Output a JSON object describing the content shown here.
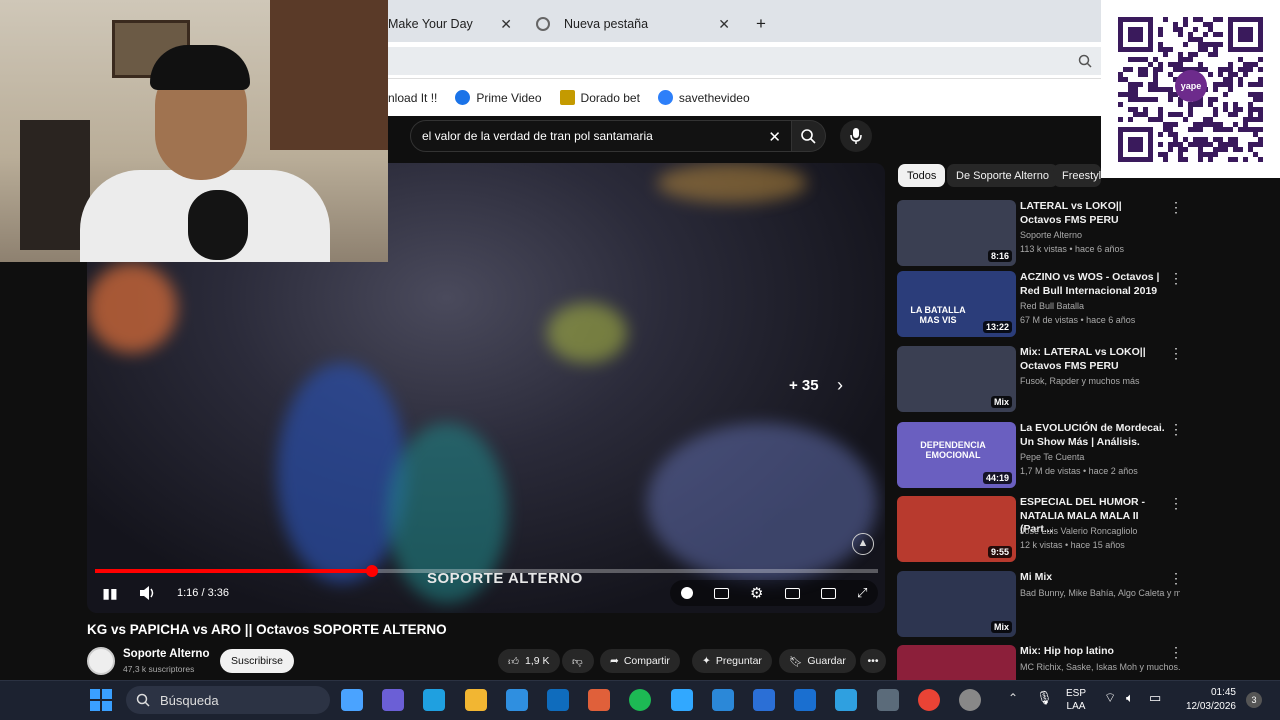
{
  "browser": {
    "tabs": [
      {
        "label": "Make Your Day",
        "close": "✕"
      },
      {
        "label": "Nueva pestaña",
        "close": "✕"
      }
    ],
    "new_tab": "+",
    "bookmarks": [
      {
        "label": "nload It !!",
        "color": "#e53935"
      },
      {
        "label": "Prime Video",
        "color": "#1a73e8"
      },
      {
        "label": "Dorado bet",
        "color": "#c49a00"
      },
      {
        "label": "savethevideo",
        "color": "#2d7ff9"
      }
    ]
  },
  "youtube": {
    "search_value": "el valor de la verdad de tran pol santamaria",
    "chips": [
      "Todos",
      "De Soporte Alterno",
      "Freestyle Rap"
    ],
    "video": {
      "overlay_count": "+ 35",
      "watermark": "SOPORTE ALTERNO",
      "time": "1:16 / 3:36",
      "progress": 0.355,
      "title": "KG vs PAPICHA vs ARO || Octavos SOPORTE ALTERNO"
    },
    "channel": {
      "name": "Soporte Alterno",
      "subs": "47,3 k suscriptores",
      "subscribe": "Suscribirse"
    },
    "actions": {
      "likes": "1,9 K",
      "share": "Compartir",
      "ask": "Preguntar",
      "save": "Guardar"
    },
    "recommendations": [
      {
        "title": "LATERAL vs LOKO|| Octavos FMS PERU",
        "channel": "Soporte Alterno",
        "meta": "113 k vistas • hace 6 años",
        "duration": "8:16",
        "bg": "#3a3f52"
      },
      {
        "title": "ACZINO vs WOS - Octavos | Red Bull Internacional 2019",
        "channel": "Red Bull Batalla",
        "meta": "67 M de vistas • hace 6 años",
        "duration": "13:22",
        "bg": "#2b3d7a"
      },
      {
        "title": "Mix: LATERAL vs LOKO|| Octavos FMS PERU",
        "channel": "Fusok, Rapder y muchos más",
        "meta": "",
        "duration": "Mix",
        "bg": "#3a3f52"
      },
      {
        "title": "La EVOLUCIÓN de Mordecai. Un Show Más | Análisis.",
        "channel": "Pepe Te Cuenta",
        "meta": "1,7 M de vistas • hace 2 años",
        "duration": "44:19",
        "bg": "#6a5fc0"
      },
      {
        "title": "ESPECIAL DEL HUMOR - NATALIA MALA MALA II (Part...",
        "channel": "José Luis Valerio Roncagliolo",
        "meta": "12 k vistas • hace 15 años",
        "duration": "9:55",
        "bg": "#b83a2e"
      },
      {
        "title": "Mi Mix",
        "channel": "Bad Bunny, Mike Bahía, Algo Caleta y mu...",
        "meta": "",
        "duration": "Mix",
        "bg": "#2d3550"
      },
      {
        "title": "Mix: Hip hop latino",
        "channel": "MC Richix, Saske, Iskas Moh y muchos...",
        "meta": "",
        "duration": "",
        "bg": "#8c1f3a"
      }
    ],
    "thumb_overlay_text": {
      "r2": "LA BATALLA MAS VIS",
      "r4": "DEPENDENCIA EMOCIONAL"
    }
  },
  "taskbar": {
    "search_placeholder": "Búsqueda",
    "lang": "ESP",
    "lang2": "LAA",
    "time": "01:45",
    "date": "12/03/2026",
    "notif": "3"
  },
  "qr_label": "yape"
}
